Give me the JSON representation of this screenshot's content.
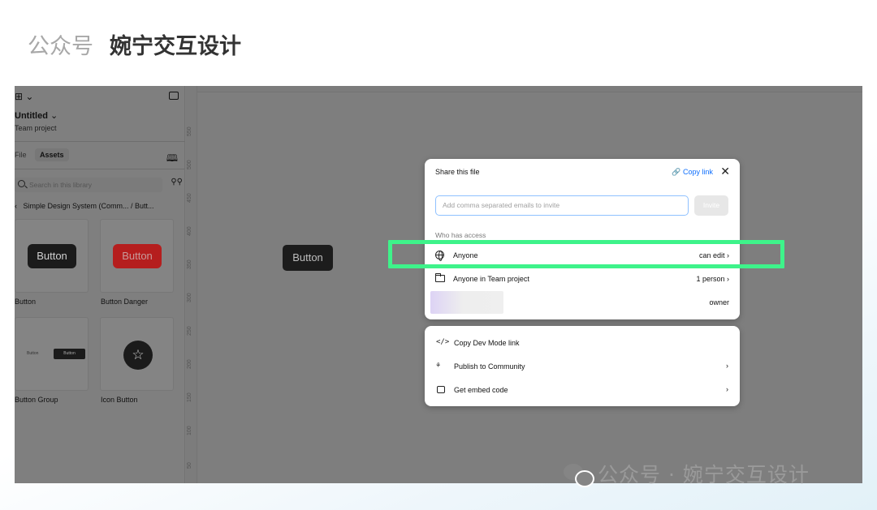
{
  "header": {
    "light": "公众号",
    "bold": "婉宁交互设计"
  },
  "sidebar": {
    "file_title": "Untitled",
    "file_subtitle": "Team project",
    "tab_file": "File",
    "tab_assets": "Assets",
    "search_placeholder": "Search in this library",
    "breadcrumb": "Simple Design System (Comm...  /  Butt...",
    "assets": [
      {
        "label": "Button",
        "preview_text": "Button"
      },
      {
        "label": "Button Danger",
        "preview_text": "Button"
      },
      {
        "label": "Button Group",
        "preview_left": "Button",
        "preview_right": "Button"
      },
      {
        "label": "Icon Button",
        "icon": "star-icon"
      }
    ]
  },
  "ruler": {
    "vertical_ticks": [
      "550",
      "500",
      "450",
      "400",
      "350",
      "300",
      "250",
      "200",
      "150",
      "100",
      "50"
    ]
  },
  "canvas": {
    "button_label": "Button"
  },
  "share": {
    "title": "Share this file",
    "copy_link": "Copy link",
    "email_placeholder": "Add comma separated emails to invite",
    "invite": "Invite",
    "who_has_access": "Who has access",
    "rows": [
      {
        "name": "Anyone",
        "permission": "can edit  ›",
        "icon": "globe-icon"
      },
      {
        "name": "Anyone in Team project",
        "permission": "1 person  ›",
        "icon": "folder-icon"
      }
    ],
    "owner": "owner"
  },
  "actions": [
    {
      "label": "Copy Dev Mode link",
      "icon": "code-icon",
      "chevron": ""
    },
    {
      "label": "Publish to Community",
      "icon": "community-icon",
      "chevron": "›"
    },
    {
      "label": "Get embed code",
      "icon": "embed-icon",
      "chevron": "›"
    }
  ],
  "watermark": "公众号 · 婉宁交互设计",
  "colors": {
    "highlight": "#3ef38a",
    "link": "#0d6efd",
    "danger_button": "#b51e1e",
    "overlay": "#7e7e7e"
  }
}
